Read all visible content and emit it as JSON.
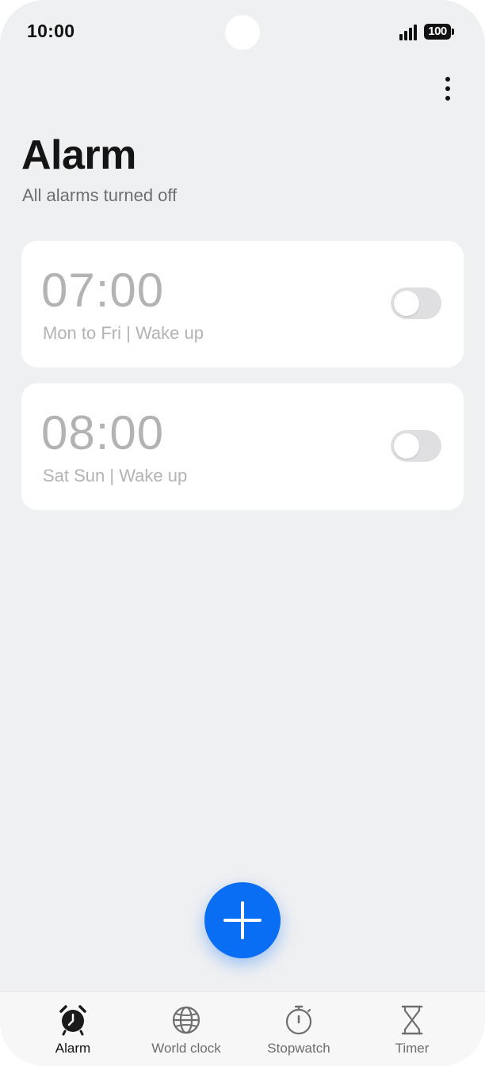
{
  "status_bar": {
    "time": "10:00",
    "battery": "100",
    "signal_icon": "signal-bars-icon"
  },
  "header": {
    "more_icon": "more-vertical-icon"
  },
  "page": {
    "title": "Alarm",
    "subtitle": "All alarms turned off"
  },
  "alarms": [
    {
      "time": "07:00",
      "label": "Mon to Fri | Wake up",
      "enabled": false
    },
    {
      "time": "08:00",
      "label": "Sat Sun | Wake up",
      "enabled": false
    }
  ],
  "fab": {
    "icon": "plus-icon"
  },
  "bottom_nav": {
    "items": [
      {
        "label": "Alarm",
        "icon": "alarm-clock-icon",
        "active": true
      },
      {
        "label": "World clock",
        "icon": "globe-icon",
        "active": false
      },
      {
        "label": "Stopwatch",
        "icon": "stopwatch-icon",
        "active": false
      },
      {
        "label": "Timer",
        "icon": "hourglass-icon",
        "active": false
      }
    ]
  },
  "colors": {
    "accent": "#0a6ef5",
    "background": "#eff0f2",
    "card": "#ffffff",
    "disabled_text": "#b3b3b5"
  }
}
